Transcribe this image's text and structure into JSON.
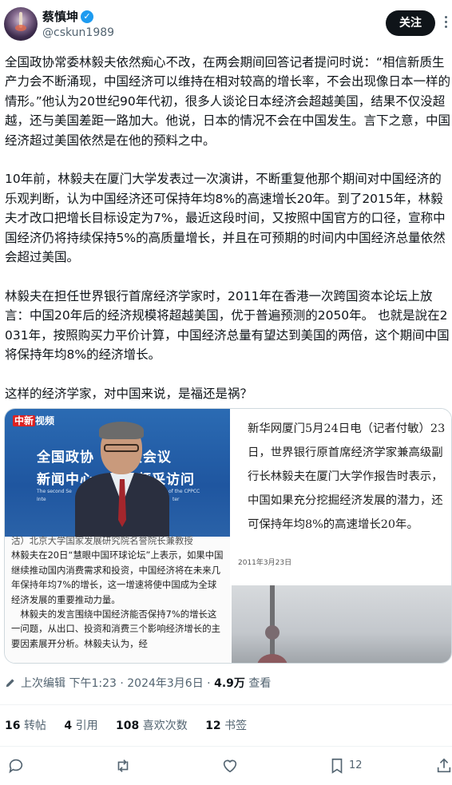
{
  "author": {
    "name": "蔡慎坤",
    "handle": "@cskun1989",
    "follow_label": "关注"
  },
  "tweet": {
    "text": "全国政协常委林毅夫依然痴心不改，在两会期间回答记者提问时说：“相信新质生产力会不断涌现，中国经济可以维持在相对较高的增长率，不会出现像日本一样的情形。”他认为20世纪90年代初，很多人谈论日本经济会超越美国，结果不仅没超越，还与美国差距一路加大。他说，日本的情况不会在中国发生。言下之意，中国经济超过美国依然是在他的预料之中。\n\n10年前，林毅夫在厦门大学发表过一次演讲，不断重复他那个期间对中国经济的乐观判断，认为中国经济还可保持年均8%的高速增长20年。到了2015年，林毅夫才改口把增长目标设定为7%，最近这段时间，又按照中国官方的口径，宣称中国经济仍将持续保持5%的高质量增长，并且在可预期的时间内中国经济总量依然会超过美国。\n\n林毅夫在担任世界银行首席经济学家时，2011年在香港一次跨国资本论坛上放言：中国20年后的经济规模将超越美国，优于普遍预测的2050年。 也就是說在2031年，按照购买力平价计算，中国经济总量有望达到美国的两倍，这个期间中国将保持年均8%的经济增长。\n\n这样的经济学家，对中国来说，是福还是祸？"
  },
  "media": {
    "video_logo_prefix": "中新",
    "video_logo_suffix": "视频",
    "banner_line1": "全国政协 　二次会议",
    "banner_line2": "新闻中心　　　频采访问",
    "banner_sub1": "The second Se",
    "banner_sub2": "of the CPPCC",
    "banner_sub3": "Inte",
    "banner_sub4": "ter",
    "left_article_first": "沽）北京大学国家发展研究院名誉院长兼教授",
    "left_article_body": "林毅夫在20日“慧眼中国环球论坛”上表示，如果中国继续推动国内消费需求和投资，中国经济将在未来几年保持年均7%的增长，这一增速将使中国成为全球经济发展的重要推动力量。\n　林毅夫的发言围绕中国经济能否保持7%的增长这一问题，从出口、投资和消费三个影响经济增长的主要因素展开分析。林毅夫认为，经",
    "right_article_text": "新华网厦门5月24日电（记者付敏）23日，世界银行原首席经济学家兼高级副行长林毅夫在厦门大学作报告时表示，中国如果充分挖掘经济发展的潜力，还可保持年均8%的高速增长20年。",
    "right_date": "2011年3月23日"
  },
  "meta": {
    "edit_label": "上次编辑",
    "time": "下午1:23",
    "date_separator": "·",
    "date": "2024年3月6日",
    "views_separator": "·",
    "views_count": "4.9万",
    "views_label": "查看"
  },
  "stats": {
    "retweets_count": "16",
    "retweets_label": "转帖",
    "quotes_count": "4",
    "quotes_label": "引用",
    "likes_count": "108",
    "likes_label": "喜欢次数",
    "bookmarks_count": "12",
    "bookmarks_label": "书签"
  },
  "actions": {
    "bookmark_count": "12"
  },
  "icons": {
    "verified": "verified-badge-icon",
    "more": "more-icon",
    "edit": "pencil-icon",
    "reply": "reply-icon",
    "retweet": "retweet-icon",
    "like": "heart-icon",
    "bookmark": "bookmark-icon",
    "share": "share-icon"
  },
  "colors": {
    "accent": "#1d9bf0",
    "text": "#0f1419",
    "secondary": "#536471"
  }
}
